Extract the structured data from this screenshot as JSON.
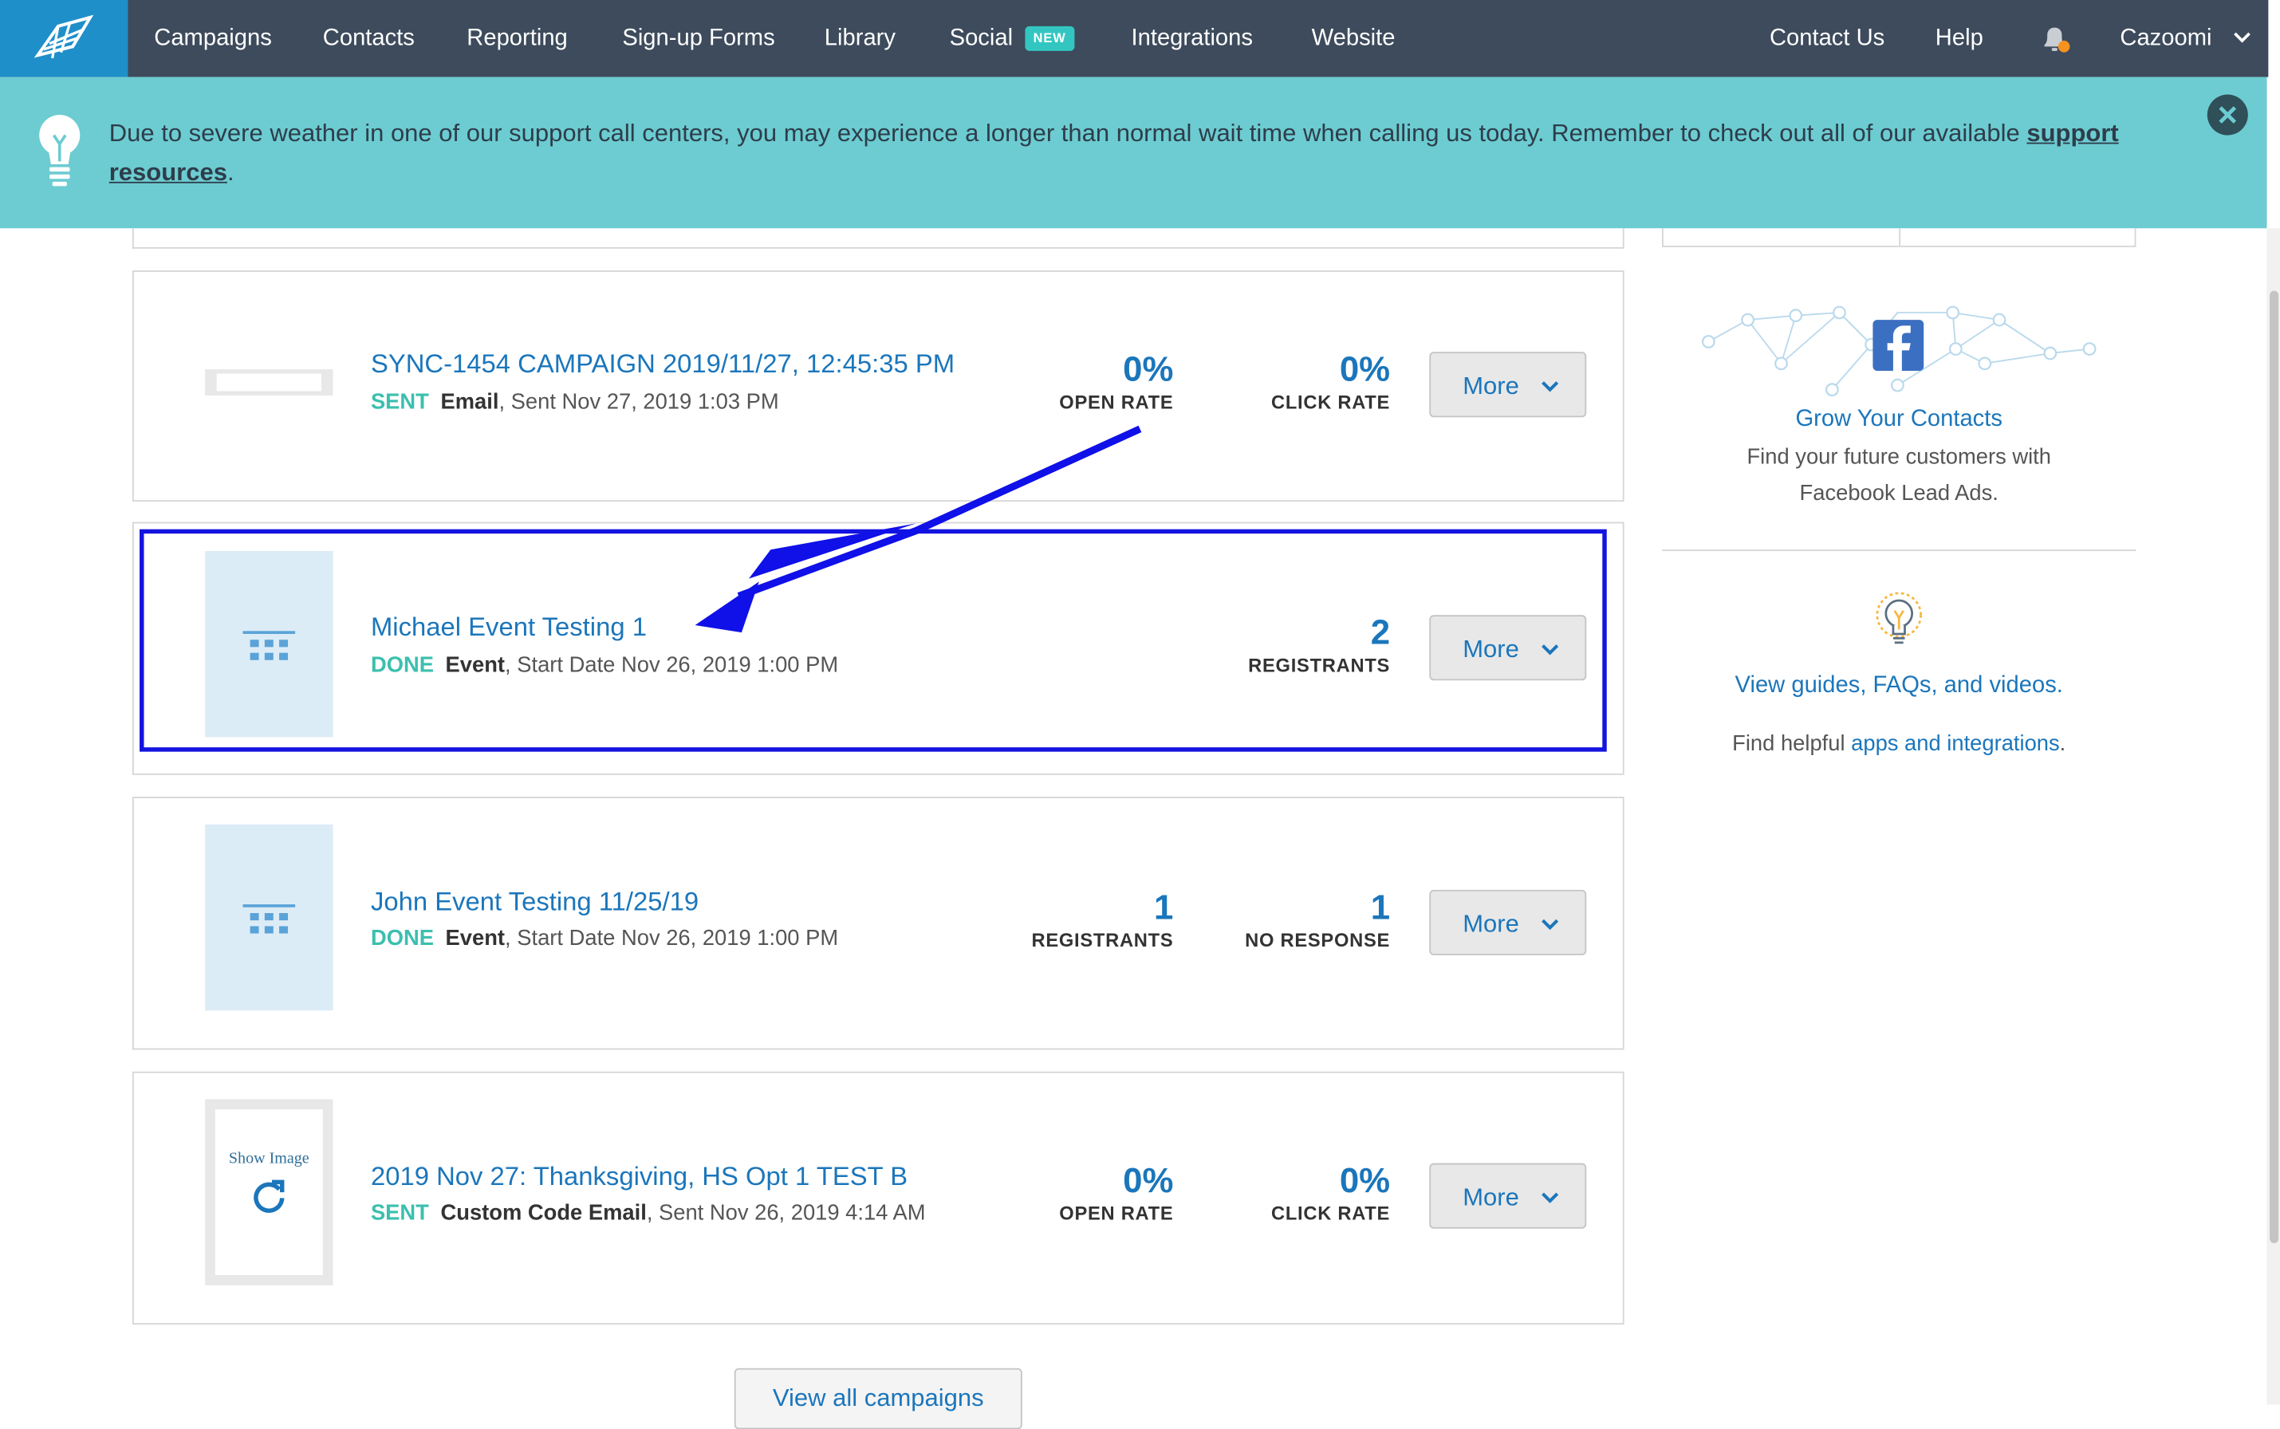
{
  "nav": {
    "items": [
      {
        "label": "Campaigns"
      },
      {
        "label": "Contacts"
      },
      {
        "label": "Reporting"
      },
      {
        "label": "Sign-up Forms"
      },
      {
        "label": "Library"
      },
      {
        "label": "Social",
        "badge": "NEW"
      },
      {
        "label": "Integrations"
      },
      {
        "label": "Website"
      }
    ],
    "right": {
      "contact": "Contact Us",
      "help": "Help",
      "account": "Cazoomi"
    }
  },
  "alert": {
    "text": "Due to severe weather in one of our support call centers, you may experience a longer than normal wait time when calling us today. Remember to check out all of our available ",
    "link": "support resources",
    "end": "."
  },
  "campaigns": [
    {
      "title": "SYNC-1454 CAMPAIGN 2019/11/27, 12:45:35 PM",
      "status": "SENT",
      "type": "Email",
      "detail": ", Sent Nov 27, 2019 1:03 PM",
      "metrics": [
        {
          "value": "0%",
          "label": "OPEN RATE"
        },
        {
          "value": "0%",
          "label": "CLICK RATE"
        }
      ],
      "button": "More"
    },
    {
      "title": "Michael Event Testing 1",
      "status": "DONE",
      "type": "Event",
      "detail": ", Start Date Nov 26, 2019 1:00 PM",
      "metrics": [
        {
          "value": "2",
          "label": "REGISTRANTS"
        }
      ],
      "button": "More"
    },
    {
      "title": "John Event Testing 11/25/19",
      "status": "DONE",
      "type": "Event",
      "detail": ", Start Date Nov 26, 2019 1:00 PM",
      "metrics": [
        {
          "value": "1",
          "label": "REGISTRANTS"
        },
        {
          "value": "1",
          "label": "NO RESPONSE"
        }
      ],
      "button": "More"
    },
    {
      "title": "2019 Nov 27: Thanksgiving, HS Opt 1 TEST B",
      "status": "SENT",
      "type": "Custom Code Email",
      "detail": ", Sent Nov 26, 2019 4:14 AM",
      "metrics": [
        {
          "value": "0%",
          "label": "OPEN RATE"
        },
        {
          "value": "0%",
          "label": "CLICK RATE"
        }
      ],
      "button": "More",
      "thumb_text": "Show Image"
    }
  ],
  "view_all": "View all campaigns",
  "sidebar": {
    "grow_title": "Grow Your Contacts",
    "grow_text": "Find your future customers with Facebook Lead Ads.",
    "guides_link": "View guides, FAQs, and videos.",
    "helpful_prefix": "Find helpful ",
    "helpful_link": "apps and integrations",
    "helpful_suffix": "."
  },
  "colors": {
    "nav_bg": "#3d4b5c",
    "logo_bg": "#1f8fc9",
    "alert_bg": "#6cccd1",
    "accent": "#1b76bb",
    "status_green": "#3cbfae",
    "highlight": "#1414e0"
  },
  "icons": [
    "logo-icon",
    "bell-icon",
    "lightbulb-icon",
    "close-icon",
    "chevron-down-icon",
    "calendar-grid-icon",
    "refresh-icon",
    "facebook-icon"
  ]
}
